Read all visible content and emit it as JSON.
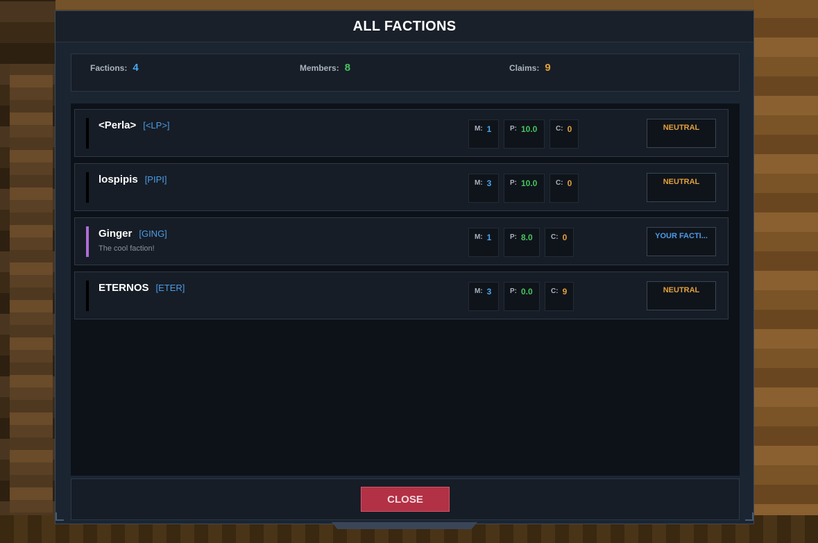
{
  "modal": {
    "title": "ALL FACTIONS",
    "close_label": "CLOSE"
  },
  "summary": {
    "factions_label": "Factions:",
    "factions_value": "4",
    "members_label": "Members:",
    "members_value": "8",
    "claims_label": "Claims:",
    "claims_value": "9"
  },
  "factions": [
    {
      "name": "<Perla>",
      "tag": "[<LP>]",
      "description": "",
      "accent": "#000000",
      "m_label": "M:",
      "members": "1",
      "p_label": "P:",
      "power": "10.0",
      "c_label": "C:",
      "claims": "0",
      "relation": "NEUTRAL"
    },
    {
      "name": "lospipis",
      "tag": "[PIPI]",
      "description": "",
      "accent": "#000000",
      "m_label": "M:",
      "members": "3",
      "p_label": "P:",
      "power": "10.0",
      "c_label": "C:",
      "claims": "0",
      "relation": "NEUTRAL"
    },
    {
      "name": "Ginger",
      "tag": "[GING]",
      "description": "The cool faction!",
      "accent": "#b06cd6",
      "m_label": "M:",
      "members": "1",
      "p_label": "P:",
      "power": "8.0",
      "c_label": "C:",
      "claims": "0",
      "relation": "YOUR FACTI..."
    },
    {
      "name": "ETERNOS",
      "tag": "[ETER]",
      "description": "",
      "accent": "#000000",
      "m_label": "M:",
      "members": "3",
      "p_label": "P:",
      "power": "0.0",
      "c_label": "C:",
      "claims": "9",
      "relation": "NEUTRAL"
    }
  ],
  "colors": {
    "members": "#49a6ee",
    "power": "#47c55d",
    "claims": "#e3a13a",
    "neutral": "#e3a13a",
    "own_faction": "#4d9be6",
    "close_button": "#b23145"
  }
}
